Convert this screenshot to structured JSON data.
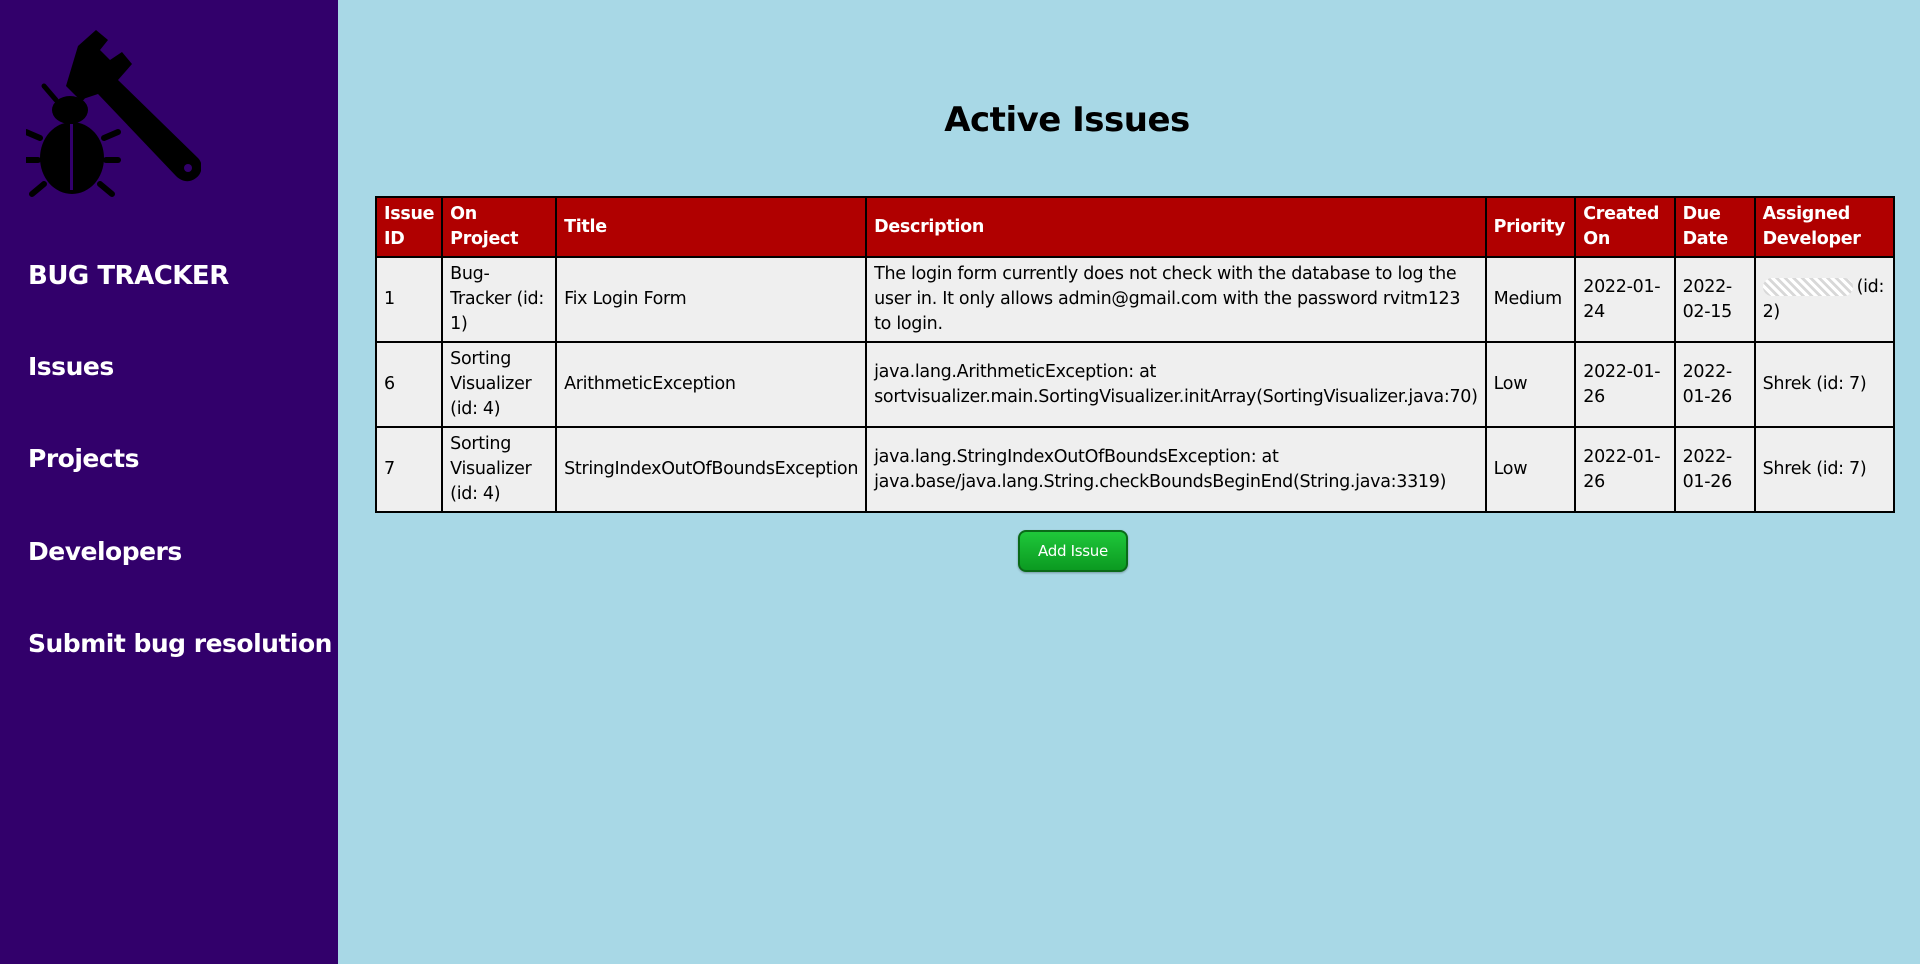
{
  "sidebar": {
    "logo_icon": "bug-wrench-icon",
    "brand": "BUG TRACKER",
    "items": [
      {
        "label": "Issues"
      },
      {
        "label": "Projects"
      },
      {
        "label": "Developers"
      },
      {
        "label": "Submit bug resolution"
      }
    ]
  },
  "main": {
    "title": "Active Issues",
    "table": {
      "headers": [
        "Issue ID",
        "On Project",
        "Title",
        "Description",
        "Priority",
        "Created On",
        "Due Date",
        "Assigned Developer"
      ],
      "rows": [
        {
          "id": "1",
          "project": "Bug-Tracker (id: 1)",
          "title": "Fix Login Form",
          "description": "The login form currently does not check with the database to log the user in. It only allows admin@gmail.com with the password rvitm123 to login.",
          "priority": "Medium",
          "created": "2022-01-24",
          "due": "2022-02-15",
          "developer": "(id: 2)"
        },
        {
          "id": "6",
          "project": "Sorting Visualizer (id: 4)",
          "title": "ArithmeticException",
          "description": "java.lang.ArithmeticException: at sortvisualizer.main.SortingVisualizer.initArray(SortingVisualizer.java:70)",
          "priority": "Low",
          "created": "2022-01-26",
          "due": "2022-01-26",
          "developer": "Shrek (id: 7)"
        },
        {
          "id": "7",
          "project": "Sorting Visualizer (id: 4)",
          "title": "StringIndexOutOfBoundsException",
          "description": "java.lang.StringIndexOutOfBoundsException: at java.base/java.lang.String.checkBoundsBeginEnd(String.java:3319)",
          "priority": "Low",
          "created": "2022-01-26",
          "due": "2022-01-26",
          "developer": "Shrek (id: 7)"
        }
      ]
    },
    "add_button": "Add Issue"
  },
  "colors": {
    "sidebar_bg": "#32006b",
    "page_bg": "#a8d8e6",
    "header_bg": "#b00000",
    "cell_bg": "#efefef",
    "button_green": "#11b02c"
  }
}
